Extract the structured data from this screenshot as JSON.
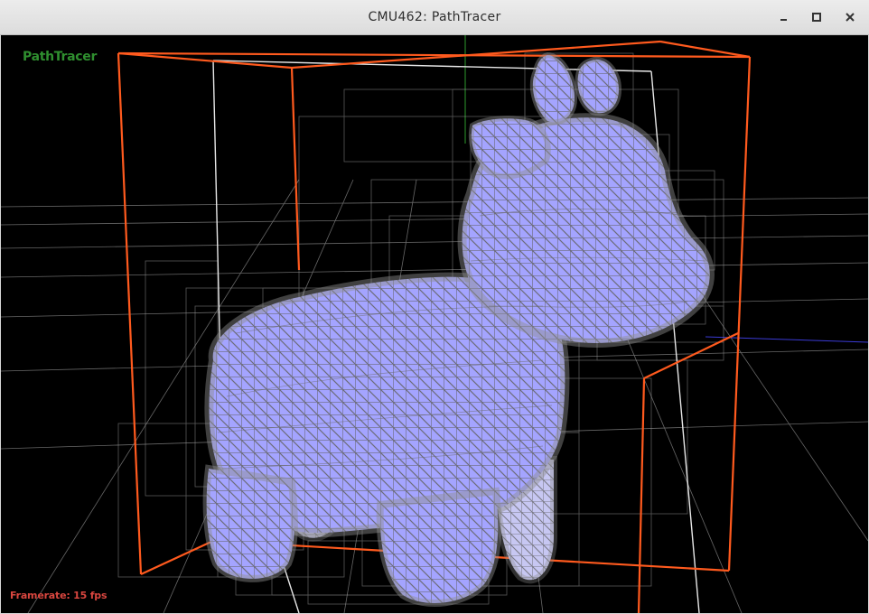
{
  "window": {
    "title": "CMU462: PathTracer",
    "controls": {
      "minimize_icon": "minimize-icon",
      "maximize_icon": "maximize-icon",
      "close_icon": "close-icon"
    }
  },
  "viewport": {
    "app_label": "PathTracer",
    "framerate_text": "Framerate: 15 fps",
    "colors": {
      "background": "#000000",
      "app_label": "#2f8f2f",
      "framerate": "#d9463f",
      "bvh_root": "#ff5a1e",
      "bvh_child": "#ffffff",
      "bvh_inner": "#9a9a9a",
      "mesh_fill": "#a4a4ff",
      "mesh_wire": "#707070"
    },
    "scene": {
      "model": "cow mesh with BVH bounding boxes",
      "view": "perspective"
    }
  }
}
